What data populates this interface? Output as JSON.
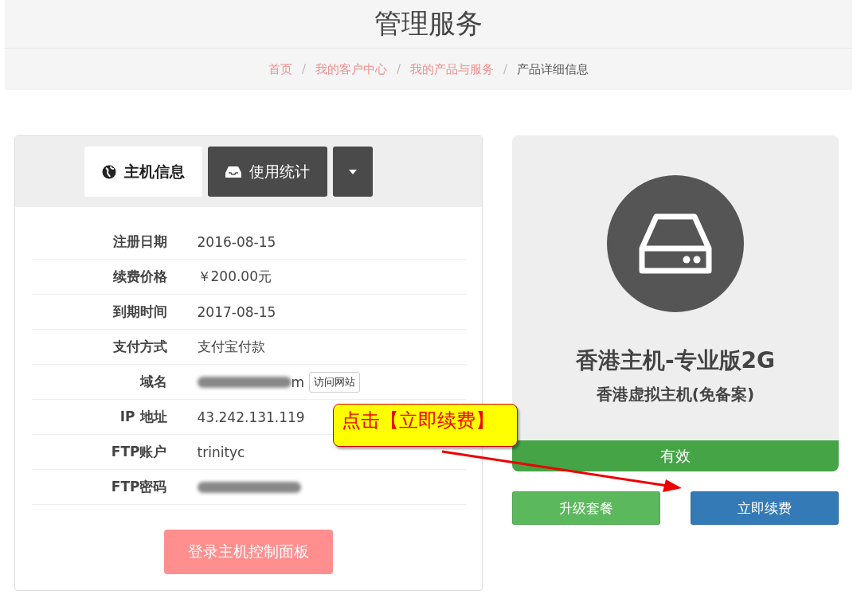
{
  "header": {
    "title": "管理服务",
    "separator": "/",
    "breadcrumb": [
      {
        "label": "首页",
        "current": false
      },
      {
        "label": "我的客户中心",
        "current": false
      },
      {
        "label": "我的产品与服务",
        "current": false
      },
      {
        "label": "产品详细信息",
        "current": true
      }
    ]
  },
  "tabs": [
    {
      "label": "主机信息",
      "selected": true,
      "kind": "globe"
    },
    {
      "label": "使用统计",
      "selected": false,
      "kind": "inbox"
    },
    {
      "kind": "dropdown",
      "selected": false
    }
  ],
  "details": [
    {
      "label": "注册日期",
      "value": "2016-08-15"
    },
    {
      "label": "续费价格",
      "value": "￥200.00元"
    },
    {
      "label": "到期时间",
      "value": "2017-08-15"
    },
    {
      "label": "支付方式",
      "value": "支付宝付款"
    },
    {
      "label": "域名",
      "value": "m",
      "redacted": true,
      "action": "访问网站"
    },
    {
      "label": "IP 地址",
      "value": "43.242.131.119"
    },
    {
      "label": "FTP账户",
      "value": "trinityc"
    },
    {
      "label": "FTP密码",
      "redacted": true
    }
  ],
  "panel_button": "登录主机控制面板",
  "product": {
    "name": "香港主机-专业版2G",
    "subtitle": "香港虚拟主机(免备案)",
    "status": "有效"
  },
  "actions": [
    {
      "label": "升级套餐",
      "color": "#5cb85c"
    },
    {
      "label": "立即续费",
      "color": "#337ab7"
    }
  ],
  "callout": "点击【立即续费】"
}
